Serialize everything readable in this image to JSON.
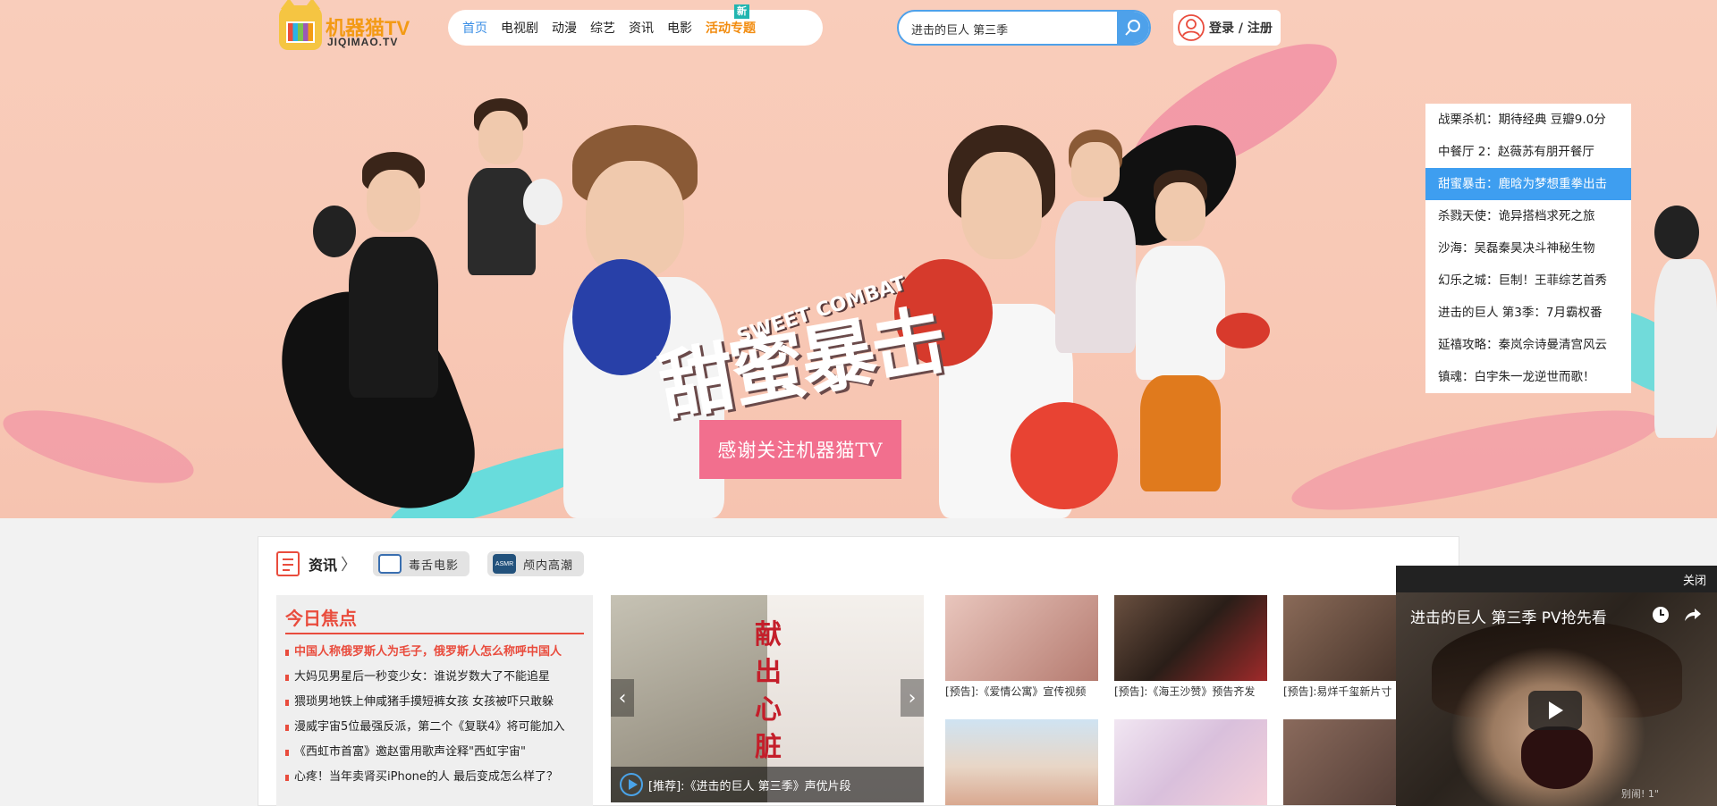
{
  "header": {
    "logo_text": "机器猫TV",
    "logo_sub": "JIQIMAO.TV",
    "nav": [
      "首页",
      "电视剧",
      "动漫",
      "综艺",
      "资讯",
      "电影",
      "活动专题"
    ],
    "nav_new_badge": "新",
    "search_value": "进击的巨人 第三季",
    "login_label": "登录 / 注册"
  },
  "hero": {
    "title_art": "甜蜜暴击",
    "title_art_sub": "SWEET COMBAT",
    "banner_text": "感谢关注机器猫TV",
    "list": [
      "战栗杀机：期待经典 豆瓣9.0分",
      "中餐厅 2：赵薇苏有朋开餐厅",
      "甜蜜暴击：鹿晗为梦想重拳出击",
      "杀戮天使：诡异搭档求死之旅",
      "沙海：吴磊秦昊决斗神秘生物",
      "幻乐之城：巨制！王菲综艺首秀",
      "进击的巨人 第3季：7月霸权番",
      "延禧攻略：秦岚佘诗曼清宫风云",
      "镇魂：白宇朱一龙逆世而歌！"
    ],
    "active_index": 2
  },
  "section": {
    "title": "资讯",
    "arrow": "〉",
    "tags": [
      "毒舌电影",
      "颅内高潮"
    ],
    "asmr_label": "ASMR",
    "focus_title": "今日焦点",
    "focus_items": [
      "中国人称俄罗斯人为毛子，俄罗斯人怎么称呼中国人",
      "大妈见男星后一秒变少女：谁说岁数大了不能追星",
      "猥琐男地铁上伸咸猪手摸短裤女孩 女孩被吓只敢躲",
      "漫威宇宙5位最强反派，第二个《复联4》将可能加入",
      "《西虹市首富》邀赵雷用歌声诠释\"西虹宇宙\"",
      "心疼！当年卖肾买iPhone的人 最后变成怎么样了？"
    ],
    "slider_text": "献出心脏",
    "slider_caption": "[推荐]:《进击的巨人 第三季》声优片段",
    "thumbs": [
      {
        "caption": "[预告]:《爱情公寓》宣传视频",
        "color": "#c98d86"
      },
      {
        "caption": "[预告]:《海王沙赞》预告齐发",
        "color": "#4a3a2e"
      },
      {
        "caption": "[预告]:易烊千玺新片寸 Man",
        "color": "#5b4a3e"
      },
      {
        "caption": "",
        "color": "#e3cfbf"
      },
      {
        "caption": "",
        "color": "#e6d8ec"
      },
      {
        "caption": "",
        "color": "#6a5044"
      }
    ]
  },
  "float_video": {
    "close_label": "关闭",
    "title": "进击的巨人 第三季 PV抢先看",
    "watermark": "别闹! 1\""
  },
  "colors": {
    "accent": "#3e9ef0",
    "hero_bg": "#f8c8b5",
    "banner": "#f26f8e",
    "focus_red": "#e94c3d",
    "nav_special": "#f28c0f"
  }
}
